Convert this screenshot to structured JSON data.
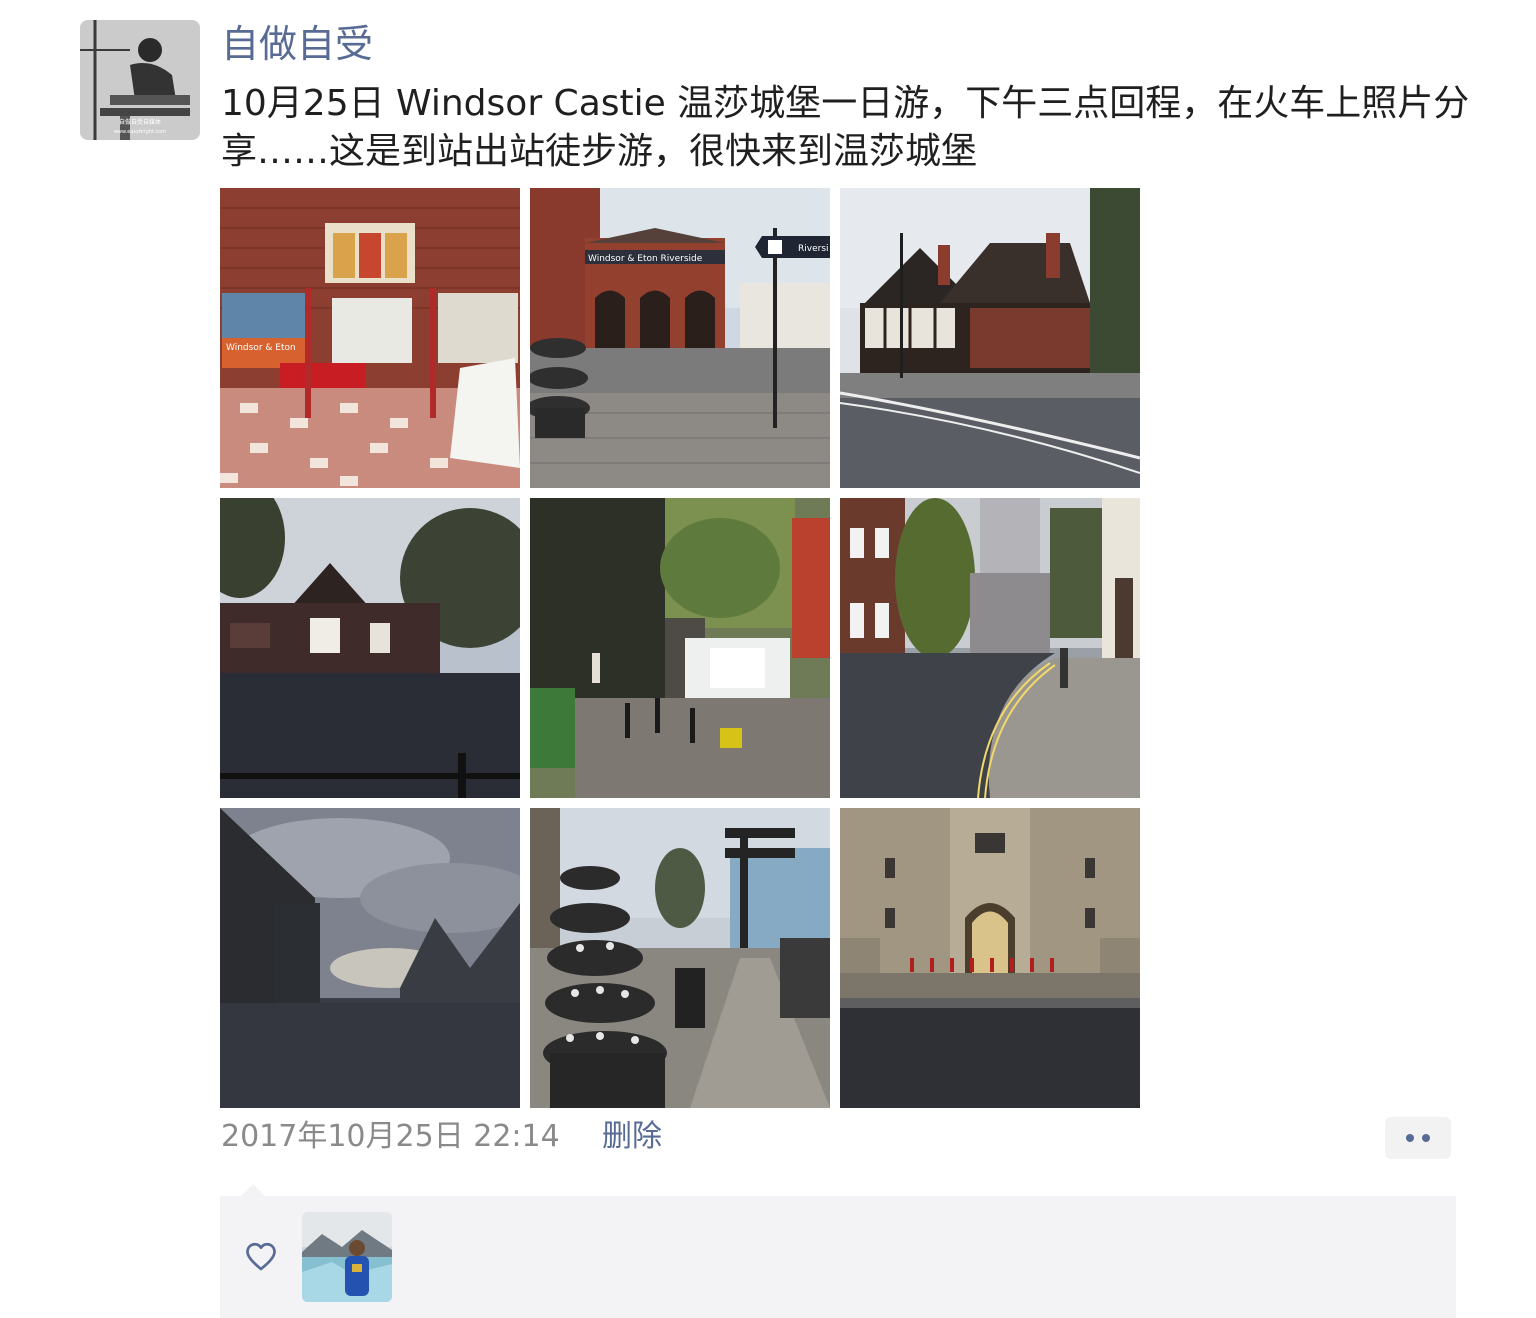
{
  "post": {
    "author": "自做自受",
    "text": "10月25日 Windsor Castie 温莎城堡一日游，下午三点回程，在火车上照片分享……这是到站出站徒步游，很快来到温莎城堡",
    "avatar_icon": "avatar-workshop-photo-icon",
    "avatar_watermark_top": "自做自受自媒体",
    "avatar_watermark_bottom": "www.easybright.com",
    "photos": [
      {
        "icon": "station-interior-photo",
        "signs": [
          "Windsor & Eton"
        ]
      },
      {
        "icon": "riverside-station-photo",
        "signs": [
          "Windsor & Eton Riverside",
          "Riversi"
        ]
      },
      {
        "icon": "tudor-house-photo",
        "signs": []
      },
      {
        "icon": "station-building-photo",
        "signs": []
      },
      {
        "icon": "van-street-photo",
        "signs": []
      },
      {
        "icon": "curved-street-photo",
        "signs": []
      },
      {
        "icon": "cloudy-street-photo",
        "signs": []
      },
      {
        "icon": "flower-tower-photo",
        "signs": []
      },
      {
        "icon": "castle-gate-photo",
        "signs": []
      }
    ],
    "timestamp": "2017年10月25日 22:14",
    "delete_label": "删除",
    "more_icon": "more-dots-icon"
  },
  "likes": {
    "heart_icon": "heart-outline-icon",
    "liker_avatar_icon": "glacier-portrait-avatar"
  },
  "colors": {
    "link": "#576b95",
    "text": "#1f1f1f",
    "meta": "#8a8a8a",
    "panel": "#f3f3f5"
  }
}
